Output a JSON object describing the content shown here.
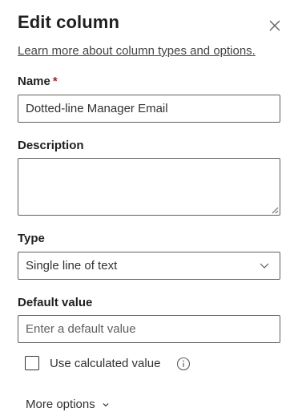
{
  "panel": {
    "title": "Edit column",
    "help_link": "Learn more about column types and options."
  },
  "name": {
    "label": "Name",
    "required_marker": "*",
    "value": "Dotted-line Manager Email"
  },
  "description": {
    "label": "Description",
    "value": ""
  },
  "type": {
    "label": "Type",
    "selected": "Single line of text"
  },
  "default_value": {
    "label": "Default value",
    "placeholder": "Enter a default value"
  },
  "calculated": {
    "label": "Use calculated value",
    "checked": false
  },
  "more_options": {
    "label": "More options"
  },
  "icons": {
    "close": "close-icon",
    "info": "info-icon",
    "dropdown": "chevron-down-icon",
    "more": "chevron-down-icon"
  }
}
